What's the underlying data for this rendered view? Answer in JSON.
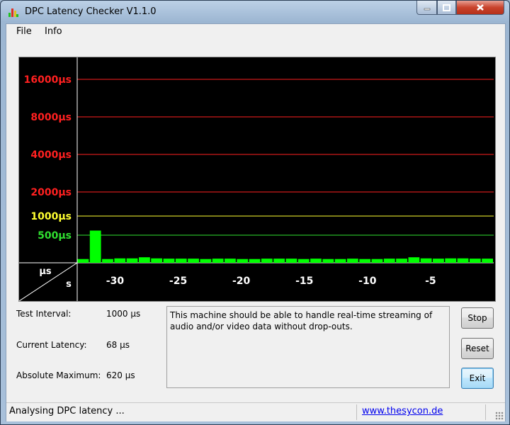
{
  "window": {
    "title": "DPC Latency Checker V1.1.0"
  },
  "menu": {
    "items": [
      "File",
      "Info"
    ]
  },
  "chart_data": {
    "type": "bar",
    "y_scale": "log",
    "y_ticks": [
      {
        "label": "16000µs",
        "value": 16000,
        "color": "#ff2020"
      },
      {
        "label": "8000µs",
        "value": 8000,
        "color": "#ff2020"
      },
      {
        "label": "4000µs",
        "value": 4000,
        "color": "#ff2020"
      },
      {
        "label": "2000µs",
        "value": 2000,
        "color": "#ff2020"
      },
      {
        "label": "1000µs",
        "value": 1000,
        "color": "#ffff30"
      },
      {
        "label": "500µs",
        "value": 500,
        "color": "#30e030"
      }
    ],
    "x_ticks": [
      -30,
      -25,
      -20,
      -15,
      -10,
      -5
    ],
    "x_range": [
      -33,
      0
    ],
    "corner_y_unit": "µs",
    "corner_x_unit": "s",
    "bar_color": "#00ff00",
    "values": [
      68,
      620,
      68,
      80,
      80,
      100,
      80,
      75,
      75,
      75,
      68,
      75,
      75,
      68,
      68,
      75,
      75,
      75,
      68,
      75,
      68,
      68,
      75,
      68,
      68,
      75,
      75,
      100,
      80,
      75,
      80,
      80,
      75,
      75
    ]
  },
  "info": {
    "test_interval_label": "Test Interval:",
    "test_interval_value": "1000 µs",
    "current_latency_label": "Current Latency:",
    "current_latency_value": "68 µs",
    "absolute_maximum_label": "Absolute Maximum:",
    "absolute_maximum_value": "620 µs"
  },
  "message": "This machine should be able to handle real-time streaming of audio and/or video data without drop-outs.",
  "buttons": {
    "stop": "Stop",
    "reset": "Reset",
    "exit": "Exit"
  },
  "status": {
    "text": "Analysing DPC latency ...",
    "link": "www.thesycon.de"
  }
}
